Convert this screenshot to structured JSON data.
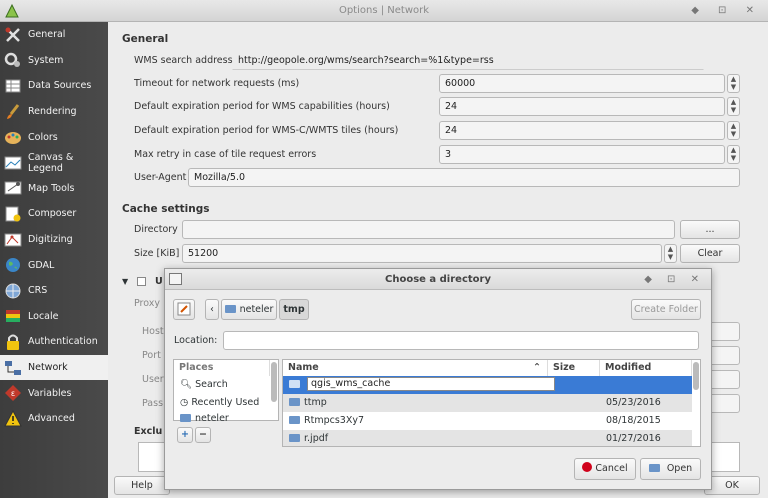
{
  "window": {
    "title": "Options | Network",
    "controls": "◆ ⊡ ✕"
  },
  "sidebar": {
    "items": [
      {
        "label": "General",
        "icon": "tools-icon"
      },
      {
        "label": "System",
        "icon": "gears-icon"
      },
      {
        "label": "Data Sources",
        "icon": "table-icon"
      },
      {
        "label": "Rendering",
        "icon": "brush-icon"
      },
      {
        "label": "Colors",
        "icon": "palette-icon"
      },
      {
        "label": "Canvas &",
        "label2": "Legend",
        "icon": "canvas-icon"
      },
      {
        "label": "Map Tools",
        "icon": "map-tools-icon"
      },
      {
        "label": "Composer",
        "icon": "composer-icon"
      },
      {
        "label": "Digitizing",
        "icon": "digitizing-icon"
      },
      {
        "label": "GDAL",
        "icon": "globe-icon"
      },
      {
        "label": "CRS",
        "icon": "crs-icon"
      },
      {
        "label": "Locale",
        "icon": "flag-icon"
      },
      {
        "label": "Authentication",
        "icon": "lock-icon"
      },
      {
        "label": "Network",
        "icon": "network-icon"
      },
      {
        "label": "Variables",
        "icon": "variables-icon"
      },
      {
        "label": "Advanced",
        "icon": "warning-icon"
      }
    ],
    "selected": "Network"
  },
  "general": {
    "heading": "General",
    "wms_label": "WMS search address",
    "wms_value": "http://geopole.org/wms/search?search=%1&type=rss",
    "timeout_label": "Timeout for network requests (ms)",
    "timeout_value": "60000",
    "wms_exp_label": "Default expiration period for WMS capabilities (hours)",
    "wms_exp_value": "24",
    "wmts_exp_label": "Default expiration period for WMS-C/WMTS tiles (hours)",
    "wmts_exp_value": "24",
    "retry_label": "Max retry in case of tile request errors",
    "retry_value": "3",
    "ua_label": "User-Agent",
    "ua_value": "Mozilla/5.0"
  },
  "cache": {
    "heading": "Cache settings",
    "dir_label": "Directory",
    "dir_value": "",
    "browse_label": "...",
    "size_label": "Size [KiB]",
    "size_value": "51200",
    "clear_label": "Clear"
  },
  "proxy": {
    "check_label": "U",
    "proxy_label": "Proxy",
    "host": "Host",
    "port": "Port",
    "user": "User",
    "pass": "Pass",
    "excl": "Exclu"
  },
  "footer": {
    "help": "Help",
    "ok": "OK"
  },
  "dialog": {
    "title": "Choose a directory",
    "controls": "◆ ⊡ ✕",
    "crumbs": [
      "neteler",
      "tmp"
    ],
    "create_folder": "Create Folder",
    "location_label": "Location:",
    "location_value": "",
    "places_header": "Places",
    "places": [
      "Search",
      "Recently Used",
      "neteler"
    ],
    "columns": {
      "name": "Name",
      "size": "Size",
      "modified": "Modified"
    },
    "new_folder_value": "qgis_wms_cache",
    "files": [
      {
        "name": "ttmp",
        "modified": "05/23/2016"
      },
      {
        "name": "Rtmpcs3Xy7",
        "modified": "08/18/2015"
      },
      {
        "name": "r.jpdf",
        "modified": "01/27/2016"
      }
    ],
    "cancel": "Cancel",
    "open": "Open"
  }
}
